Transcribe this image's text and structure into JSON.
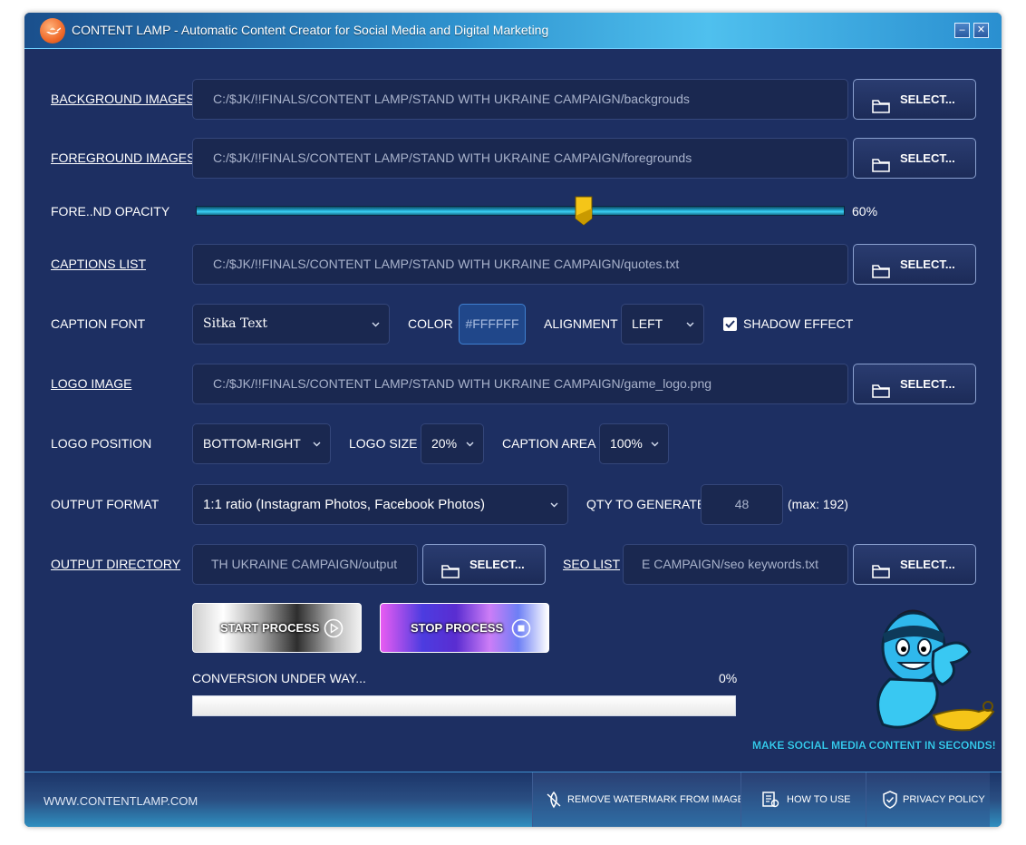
{
  "window": {
    "title": "CONTENT LAMP - Automatic Content Creator for Social Media and Digital Marketing",
    "minimize_label": "–",
    "close_label": "✕"
  },
  "rows": {
    "background_images": {
      "label": "BACKGROUND IMAGES",
      "path": "C:/$JK/!!FINALS/CONTENT LAMP/STAND WITH UKRAINE CAMPAIGN/backgrouds",
      "button": "SELECT..."
    },
    "foreground_images": {
      "label": "FOREGROUND IMAGES",
      "path": "C:/$JK/!!FINALS/CONTENT LAMP/STAND WITH UKRAINE CAMPAIGN/foregrounds",
      "button": "SELECT..."
    },
    "opacity": {
      "label": "FORE..ND OPACITY",
      "value_text": "60%",
      "value": 0.6
    },
    "captions_list": {
      "label": "CAPTIONS LIST",
      "path": "C:/$JK/!!FINALS/CONTENT LAMP/STAND WITH UKRAINE CAMPAIGN/quotes.txt",
      "button": "SELECT..."
    },
    "caption_font": {
      "label": "CAPTION FONT",
      "font": "Sitka Text",
      "color_label": "COLOR",
      "color_value": "#FFFFFF",
      "alignment_label": "ALIGNMENT",
      "alignment_value": "LEFT",
      "shadow_label": "SHADOW EFFECT",
      "shadow_checked": true
    },
    "logo_image": {
      "label": "LOGO IMAGE",
      "path": "C:/$JK/!!FINALS/CONTENT LAMP/STAND WITH UKRAINE CAMPAIGN/game_logo.png",
      "button": "SELECT..."
    },
    "logo_position": {
      "label": "LOGO POSITION",
      "value": "BOTTOM-RIGHT",
      "size_label": "LOGO SIZE",
      "size_value": "20%",
      "caption_area_label": "CAPTION AREA",
      "caption_area_value": "100%"
    },
    "output_format": {
      "label": "OUTPUT FORMAT",
      "value": "1:1 ratio (Instagram Photos, Facebook Photos)",
      "qty_label": "QTY TO GENERATE",
      "qty_value": "48",
      "qty_max": "(max: 192)"
    },
    "output_directory": {
      "label": "OUTPUT DIRECTORY",
      "path": "TH UKRAINE CAMPAIGN/output",
      "button": "SELECT...",
      "seo_label": "SEO LIST",
      "seo_path": "E CAMPAIGN/seo keywords.txt",
      "seo_button": "SELECT..."
    }
  },
  "actions": {
    "start": "START PROCESS",
    "stop": "STOP PROCESS"
  },
  "progress": {
    "status": "CONVERSION UNDER WAY...",
    "percent_text": "0%",
    "value": 0
  },
  "tagline": "MAKE SOCIAL MEDIA CONTENT IN SECONDS!",
  "footer": {
    "website": "WWW.CONTENTLAMP.COM",
    "remove_watermark": "REMOVE WATERMARK FROM IMAGES",
    "how_to_use": "HOW TO USE",
    "privacy_policy": "PRIVACY POLICY"
  },
  "colors": {
    "window_bg": "#1d2f62",
    "field_bg": "#1a2850",
    "accent_cyan": "#36c8f0",
    "slider_thumb": "#f5c518"
  },
  "icons": [
    "app-lamp-icon",
    "folder-icon",
    "chevron-down-icon",
    "check-icon",
    "play-icon",
    "stop-icon",
    "watermark-icon",
    "how-to-use-icon",
    "shield-icon",
    "genie-mascot"
  ]
}
